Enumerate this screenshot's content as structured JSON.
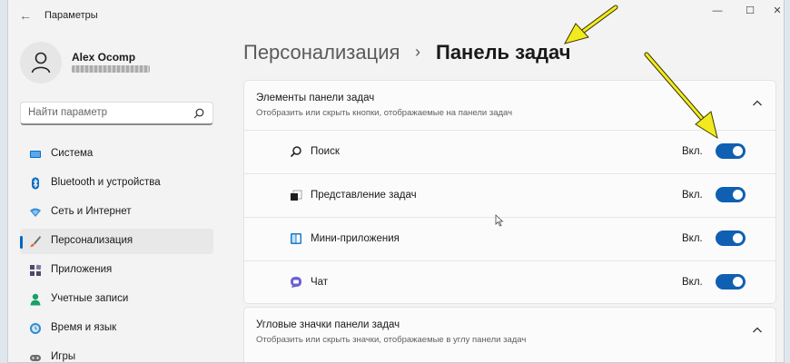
{
  "window": {
    "title": "Параметры",
    "back_icon": "←",
    "minimize": "—",
    "maximize": "☐",
    "close": "✕"
  },
  "user": {
    "name": "Alex Ocomp"
  },
  "search": {
    "placeholder": "Найти параметр"
  },
  "sidebar": {
    "items": [
      {
        "label": "Система",
        "icon": "system-icon",
        "color": "#0f6cbd",
        "active": false
      },
      {
        "label": "Bluetooth и устройства",
        "icon": "bluetooth-icon",
        "color": "#0f6cbd",
        "active": false
      },
      {
        "label": "Сеть и Интернет",
        "icon": "network-icon",
        "color": "#3b8fd6",
        "active": false
      },
      {
        "label": "Персонализация",
        "icon": "brush-icon",
        "color": "#e36a2e",
        "active": true
      },
      {
        "label": "Приложения",
        "icon": "apps-icon",
        "color": "#4a4a6a",
        "active": false
      },
      {
        "label": "Учетные записи",
        "icon": "accounts-icon",
        "color": "#1aa06a",
        "active": false
      },
      {
        "label": "Время и язык",
        "icon": "time-language-icon",
        "color": "#2f8ccf",
        "active": false
      },
      {
        "label": "Игры",
        "icon": "games-icon",
        "color": "#6d6d6d",
        "active": false
      }
    ]
  },
  "breadcrumb": {
    "parent": "Персонализация",
    "separator": "›",
    "current": "Панель задач"
  },
  "taskbar_items_group": {
    "title": "Элементы панели задач",
    "subtitle": "Отобразить или скрыть кнопки, отображаемые на панели задач",
    "expanded": true,
    "rows": [
      {
        "label": "Поиск",
        "icon": "search-icon",
        "state": "Вкл.",
        "on": true
      },
      {
        "label": "Представление задач",
        "icon": "task-view-icon",
        "state": "Вкл.",
        "on": true
      },
      {
        "label": "Мини-приложения",
        "icon": "widgets-icon",
        "state": "Вкл.",
        "on": true
      },
      {
        "label": "Чат",
        "icon": "chat-icon",
        "state": "Вкл.",
        "on": true
      }
    ]
  },
  "corner_icons_group": {
    "title": "Угловые значки панели задач",
    "subtitle": "Отобразить или скрыть значки, отображаемые в углу панели задач",
    "expanded": false
  },
  "colors": {
    "accent": "#0f5fb2",
    "annotation_arrow": "#f2ea1f"
  }
}
